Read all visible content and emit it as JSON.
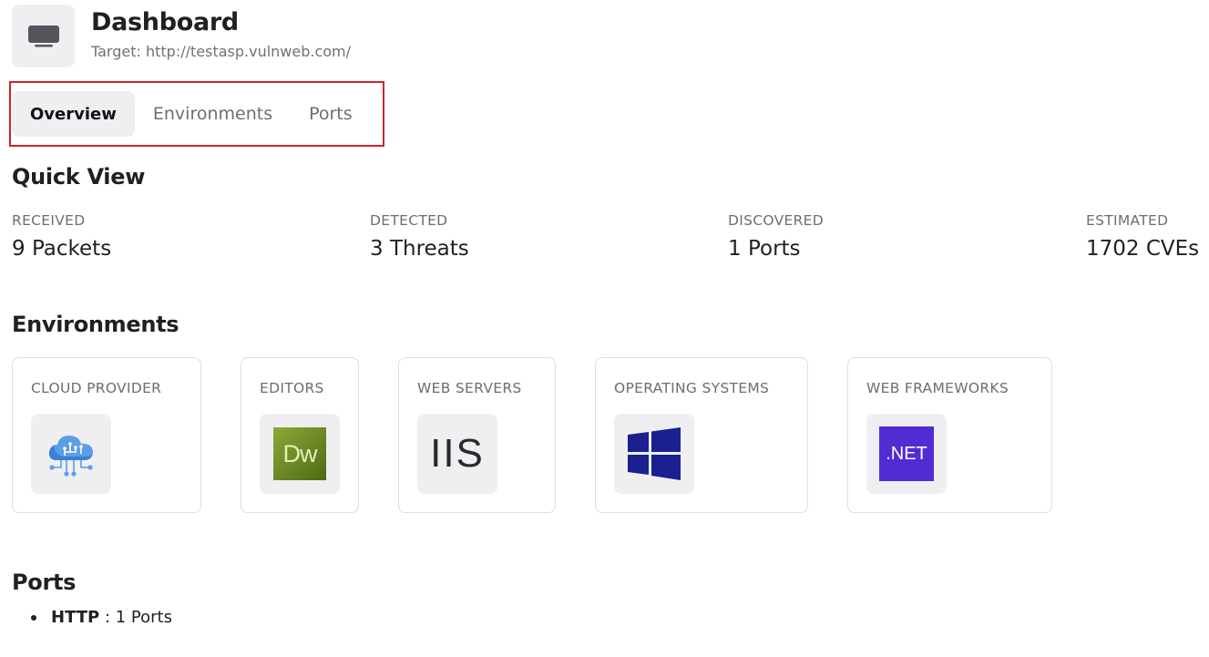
{
  "header": {
    "icon": "monitor-icon",
    "title": "Dashboard",
    "target": "Target: http://testasp.vulnweb.com/"
  },
  "tabs": [
    {
      "label": "Overview",
      "active": true
    },
    {
      "label": "Environments",
      "active": false
    },
    {
      "label": "Ports",
      "active": false
    }
  ],
  "colors": {
    "highlight": "#d3222a",
    "tab_active_bg": "#efeff1",
    "card_border": "#dedee2",
    "muted_text": "#6d6d75"
  },
  "quick_view": {
    "heading": "Quick View",
    "stats": [
      {
        "label": "RECEIVED",
        "value": "9 Packets"
      },
      {
        "label": "DETECTED",
        "value": "3 Threats"
      },
      {
        "label": "DISCOVERED",
        "value": "1 Ports"
      },
      {
        "label": "ESTIMATED",
        "value": "1702 CVEs"
      }
    ]
  },
  "environments": {
    "heading": "Environments",
    "cards": [
      {
        "label": "CLOUD PROVIDER",
        "icon": "cloud-network-icon"
      },
      {
        "label": "EDITORS",
        "icon": "dreamweaver-logo",
        "icon_text": "Dw"
      },
      {
        "label": "WEB SERVERS",
        "icon": "iis-logo",
        "icon_text": "IIS"
      },
      {
        "label": "OPERATING SYSTEMS",
        "icon": "windows-logo"
      },
      {
        "label": "WEB FRAMEWORKS",
        "icon": "dotnet-logo",
        "icon_text": ".NET"
      }
    ]
  },
  "ports": {
    "heading": "Ports",
    "items": [
      {
        "name": "HTTP",
        "detail": " : 1 Ports"
      }
    ]
  }
}
